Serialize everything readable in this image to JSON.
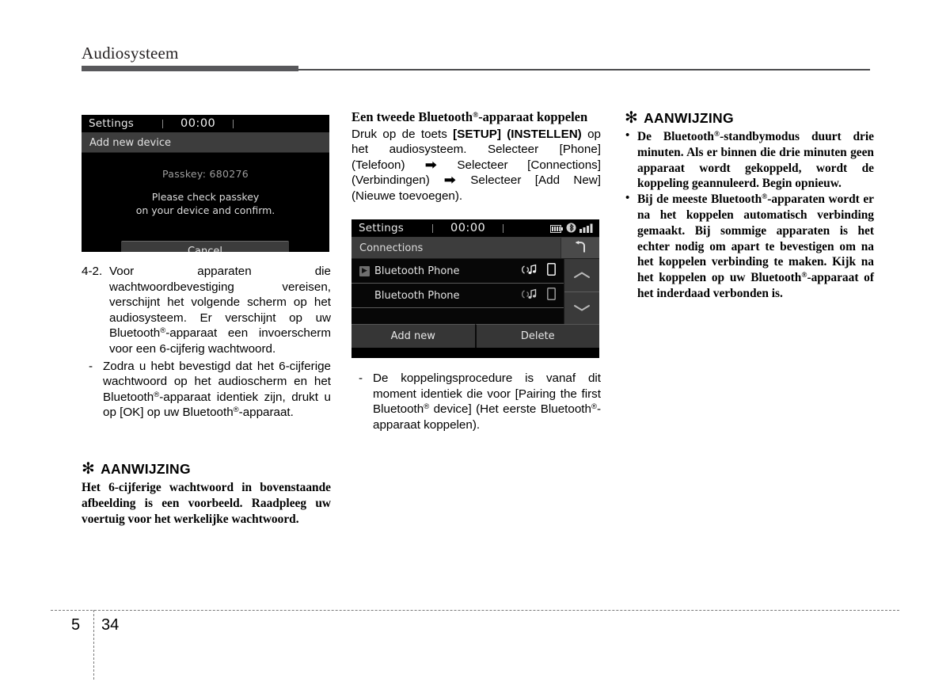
{
  "header": {
    "title": "Audiosysteem"
  },
  "device_passkey": {
    "title": "Settings",
    "clock": "00:00",
    "subtitle": "Add new device",
    "passkey_line": "Passkey: 680276",
    "confirm_line1": "Please check passkey",
    "confirm_line2": "on your device and confirm.",
    "cancel_label": "Cancel"
  },
  "device_connections": {
    "title": "Settings",
    "clock": "00:00",
    "subtitle": "Connections",
    "back_icon": "back-arrow-icon",
    "status_icons": [
      "battery-icon",
      "bluetooth-icon",
      "signal-icon"
    ],
    "rows": [
      {
        "label": "Bluetooth Phone",
        "selected": true,
        "icons": [
          "audio-stream-icon",
          "phone-icon"
        ]
      },
      {
        "label": "Bluetooth Phone",
        "selected": false,
        "icons": [
          "audio-stream-icon",
          "phone-icon"
        ]
      }
    ],
    "scroll_up_icon": "chevron-up-icon",
    "scroll_down_icon": "chevron-down-icon",
    "buttons": [
      "Add new",
      "Delete"
    ]
  },
  "left_column": {
    "step_marker": "4-2.",
    "step_text_a": "Voor apparaten die wachtwoordbevestiging vereisen, verschijnt het volgende scherm op het audiosysteem. Er verschijnt op uw Bluetooth",
    "step_text_b": "-apparaat een invoerscherm voor een 6-cijferig wachtwoord.",
    "dash_marker": "-",
    "dash_text_a": "Zodra u hebt bevestigd dat het 6-cijferige wachtwoord op het audioscherm en het Bluetooth",
    "dash_text_b": "-apparaat identiek zijn, drukt u op [OK] op uw Bluetooth",
    "dash_text_c": "-apparaat.",
    "note": {
      "asterisk": "✻",
      "title": "AANWIJZING",
      "body": "Het 6-cijferige wachtwoord in bovenstaande afbeelding is een voorbeeld. Raadpleeg uw voertuig voor het werkelijke wachtwoord."
    }
  },
  "mid_column": {
    "heading_a": "Een tweede Bluetooth",
    "heading_b": "-apparaat koppelen",
    "intro_a": "Druk op de toets ",
    "intro_bold": "[SETUP] (INSTELLEN)",
    "intro_b": " op het audiosysteem. Selecteer [Phone] (Telefoon) ",
    "arrow": "➡",
    "intro_c": " Selecteer [Connections] (Verbindingen) ",
    "intro_d": " Selecteer [Add New] (Nieuwe toevoegen).",
    "dash_marker": "-",
    "dash_text_a": "De koppelingsprocedure is vanaf dit moment identiek die voor [Pairing the first Bluetooth",
    "dash_text_b": " device] (Het eerste Bluetooth",
    "dash_text_c": "-apparaat koppelen)."
  },
  "right_column": {
    "note": {
      "asterisk": "✻",
      "title": "AANWIJZING",
      "bullet_char": "•",
      "bullet1_a": "De Bluetooth",
      "bullet1_b": "-standbymodus duurt drie minuten. Als er binnen die drie minuten geen apparaat wordt gekoppeld, wordt de koppeling geannuleerd. Begin opnieuw.",
      "bullet2_a": "Bij de meeste Bluetooth",
      "bullet2_b": "-apparaten wordt er na het koppelen automatisch verbinding gemaakt. Bij sommige apparaten is het echter nodig om apart te bevestigen om na het koppelen verbinding te maken. Kijk na het koppelen op uw Bluetooth",
      "bullet2_c": "-apparaat of het inderdaad verbonden is."
    }
  },
  "footer": {
    "chapter": "5",
    "page": "34"
  },
  "registered_mark": "®"
}
